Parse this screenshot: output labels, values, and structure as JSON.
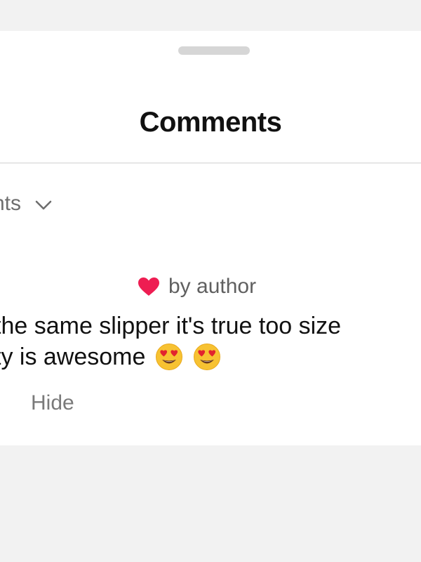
{
  "sheet": {
    "title": "Comments"
  },
  "sort": {
    "label": "nts"
  },
  "comment": {
    "badge": "by author",
    "line1": "the same slipper it's true too size",
    "line2": "ty is awesome",
    "emojis": [
      "heart-eyes-emoji",
      "heart-eyes-emoji"
    ],
    "hide_label": "Hide"
  },
  "colors": {
    "heart": "#ee1d52",
    "text": "#111111",
    "muted": "#6e6e6e"
  }
}
